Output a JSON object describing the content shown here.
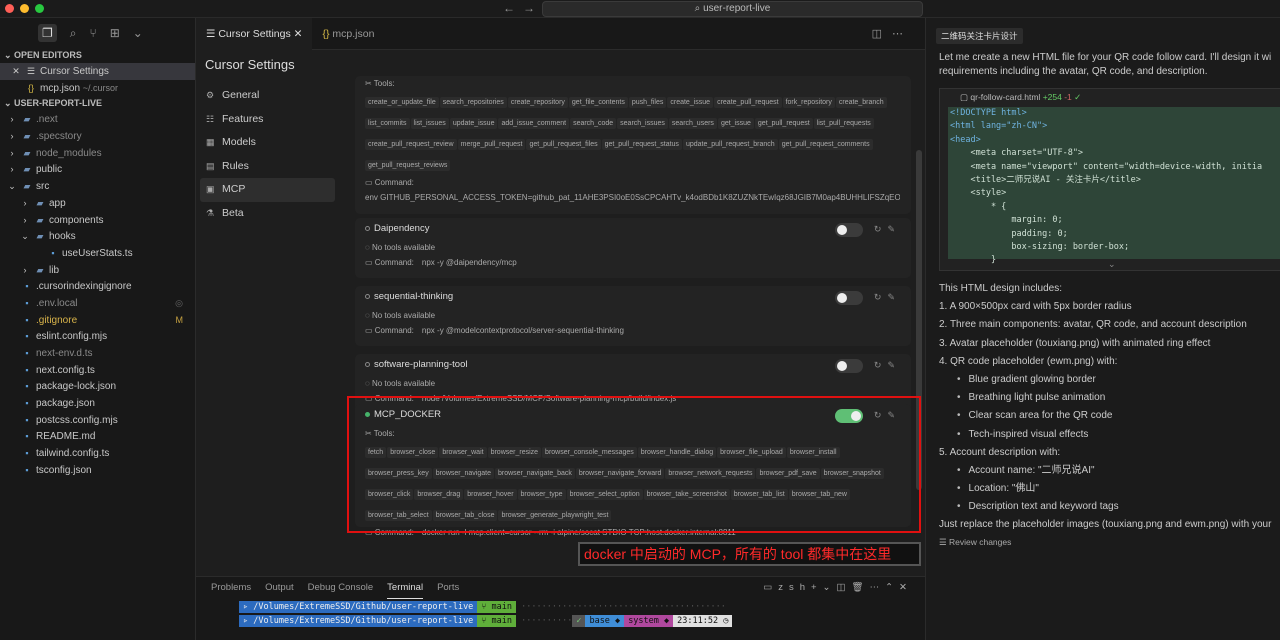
{
  "window": {
    "search_label": "user-report-live",
    "dot_colors": [
      "#ff5f57",
      "#febc2e",
      "#28c840"
    ]
  },
  "explorer": {
    "open_editors_title": "OPEN EDITORS",
    "open_editors": [
      {
        "name": "Cursor Settings",
        "hint": ""
      },
      {
        "name": "mcp.json",
        "hint": "~/.cursor"
      }
    ],
    "project_title": "USER-REPORT-LIVE",
    "tree": [
      {
        "name": ".next",
        "kind": "folder",
        "depth": 0,
        "dim": true
      },
      {
        "name": ".specstory",
        "kind": "folder",
        "depth": 0,
        "dim": true
      },
      {
        "name": "node_modules",
        "kind": "folder",
        "depth": 0,
        "dim": true
      },
      {
        "name": "public",
        "kind": "folder",
        "depth": 0
      },
      {
        "name": "src",
        "kind": "folder-open",
        "depth": 0
      },
      {
        "name": "app",
        "kind": "folder",
        "depth": 1
      },
      {
        "name": "components",
        "kind": "folder",
        "depth": 1
      },
      {
        "name": "hooks",
        "kind": "folder-open",
        "depth": 1
      },
      {
        "name": "useUserStats.ts",
        "kind": "file",
        "depth": 2
      },
      {
        "name": "lib",
        "kind": "folder",
        "depth": 1
      },
      {
        "name": ".cursorindexingignore",
        "kind": "file",
        "depth": 0
      },
      {
        "name": ".env.local",
        "kind": "file",
        "depth": 0,
        "dim": true,
        "mark": "◎"
      },
      {
        "name": ".gitignore",
        "kind": "file",
        "depth": 0,
        "gold": true,
        "mark": "M"
      },
      {
        "name": "eslint.config.mjs",
        "kind": "file",
        "depth": 0
      },
      {
        "name": "next-env.d.ts",
        "kind": "file",
        "depth": 0,
        "dim": true
      },
      {
        "name": "next.config.ts",
        "kind": "file",
        "depth": 0
      },
      {
        "name": "package-lock.json",
        "kind": "file",
        "depth": 0
      },
      {
        "name": "package.json",
        "kind": "file",
        "depth": 0
      },
      {
        "name": "postcss.config.mjs",
        "kind": "file",
        "depth": 0
      },
      {
        "name": "README.md",
        "kind": "file",
        "depth": 0
      },
      {
        "name": "tailwind.config.ts",
        "kind": "file",
        "depth": 0
      },
      {
        "name": "tsconfig.json",
        "kind": "file",
        "depth": 0
      }
    ]
  },
  "tabs": [
    {
      "label": "Cursor Settings",
      "active": true
    },
    {
      "label": "mcp.json",
      "active": false
    }
  ],
  "settings": {
    "title": "Cursor Settings",
    "nav": [
      {
        "label": "General",
        "icon": "⚙"
      },
      {
        "label": "Features",
        "icon": "☷"
      },
      {
        "label": "Models",
        "icon": "▦"
      },
      {
        "label": "Rules",
        "icon": "▤"
      },
      {
        "label": "MCP",
        "icon": "▣",
        "selected": true
      },
      {
        "label": "Beta",
        "icon": "⚗"
      }
    ],
    "tools_label": "Tools:",
    "command_label": "Command:",
    "no_tools": "No tools available",
    "github": {
      "tools": [
        "create_or_update_file",
        "search_repositories",
        "create_repository",
        "get_file_contents",
        "push_files",
        "create_issue",
        "create_pull_request",
        "fork_repository",
        "create_branch",
        "list_commits",
        "list_issues",
        "update_issue",
        "add_issue_comment",
        "search_code",
        "search_issues",
        "search_users",
        "get_issue",
        "get_pull_request",
        "list_pull_requests",
        "create_pull_request_review",
        "merge_pull_request",
        "get_pull_request_files",
        "get_pull_request_status",
        "update_pull_request_branch",
        "get_pull_request_comments",
        "get_pull_request_reviews"
      ],
      "command": "env GITHUB_PERSONAL_ACCESS_TOKEN=github_pat_11AHE3PSI0oE0SsCPCAHTv_k4odBDb1K8ZUZNkTEwIqz68JGIB7M0ap4BUHHLIFSZqEOT..."
    },
    "servers": [
      {
        "name": "Daipendency",
        "enabled": false,
        "command": "npx -y @daipendency/mcp"
      },
      {
        "name": "sequential-thinking",
        "enabled": false,
        "command": "npx -y @modelcontextprotocol/server-sequential-thinking"
      },
      {
        "name": "software-planning-tool",
        "enabled": false,
        "command": "node /Volumes/ExtremeSSD/MCP/Software-planning-mcp/build/index.js"
      }
    ],
    "docker": {
      "name": "MCP_DOCKER",
      "enabled": true,
      "tools": [
        "fetch",
        "browser_close",
        "browser_wait",
        "browser_resize",
        "browser_console_messages",
        "browser_handle_dialog",
        "browser_file_upload",
        "browser_install",
        "browser_press_key",
        "browser_navigate",
        "browser_navigate_back",
        "browser_navigate_forward",
        "browser_network_requests",
        "browser_pdf_save",
        "browser_snapshot",
        "browser_click",
        "browser_drag",
        "browser_hover",
        "browser_type",
        "browser_select_option",
        "browser_take_screenshot",
        "browser_tab_list",
        "browser_tab_new",
        "browser_tab_select",
        "browser_tab_close",
        "browser_generate_playwright_test"
      ],
      "command": "docker run -l mcp.client=cursor --rm -i alpine/socat STDIO TCP:host.docker.internal:8811"
    },
    "annotation": "docker 中启动的 MCP，所有的 tool 都集中在这里",
    "highlight_color": "#e01010"
  },
  "terminal": {
    "tabs": [
      "Problems",
      "Output",
      "Debug Console",
      "Terminal",
      "Ports"
    ],
    "active_tab": "Terminal",
    "shell": "zsh",
    "lines": [
      {
        "path": "/Volumes/ExtremeSSD/Github/user-report-live",
        "branch": "main"
      },
      {
        "path": "/Volumes/ExtremeSSD/Github/user-report-live",
        "branch": "main",
        "check": "✓",
        "env": "base",
        "sys": "system",
        "time": "23:11:52"
      }
    ]
  },
  "chat": {
    "title": "二维码关注卡片设计",
    "intro_1": "Let me create a new HTML file for your QR code follow card. I'll design it wi",
    "intro_2": "requirements including the avatar, QR code, and description.",
    "file": {
      "name": "qr-follow-card.html",
      "added": "+254",
      "removed": "-1",
      "status": "✓"
    },
    "code_lines": [
      "<!DOCTYPE html>",
      "<html lang=\"zh-CN\">",
      "<head>",
      "    <meta charset=\"UTF-8\">",
      "    <meta name=\"viewport\" content=\"width=device-width, initia",
      "    <title>二师兄说AI - 关注卡片</title>",
      "    <style>",
      "        * {",
      "            margin: 0;",
      "            padding: 0;",
      "            box-sizing: border-box;",
      "        }"
    ],
    "summary_intro": "This HTML design includes:",
    "items": [
      {
        "text": "1. A 900×500px card with 5px border radius",
        "sub": false
      },
      {
        "text": "2. Three main components: avatar, QR code, and account description",
        "sub": false
      },
      {
        "text": "3. Avatar placeholder (touxiang.png) with animated ring effect",
        "sub": false
      },
      {
        "text": "4. QR code placeholder (ewm.png) with:",
        "sub": false
      },
      {
        "text": "Blue gradient glowing border",
        "sub": true
      },
      {
        "text": "Breathing light pulse animation",
        "sub": true
      },
      {
        "text": "Clear scan area for the QR code",
        "sub": true
      },
      {
        "text": "Tech-inspired visual effects",
        "sub": true
      },
      {
        "text": "5. Account description with:",
        "sub": false
      },
      {
        "text": "Account name: \"二师兄说AI\"",
        "sub": true
      },
      {
        "text": "Location: \"佛山\"",
        "sub": true
      },
      {
        "text": "Description text and keyword tags",
        "sub": true
      },
      {
        "text": "Just replace the placeholder images (touxiang.png and ewm.png) with your",
        "sub": false
      }
    ],
    "review_label": "Review changes"
  }
}
